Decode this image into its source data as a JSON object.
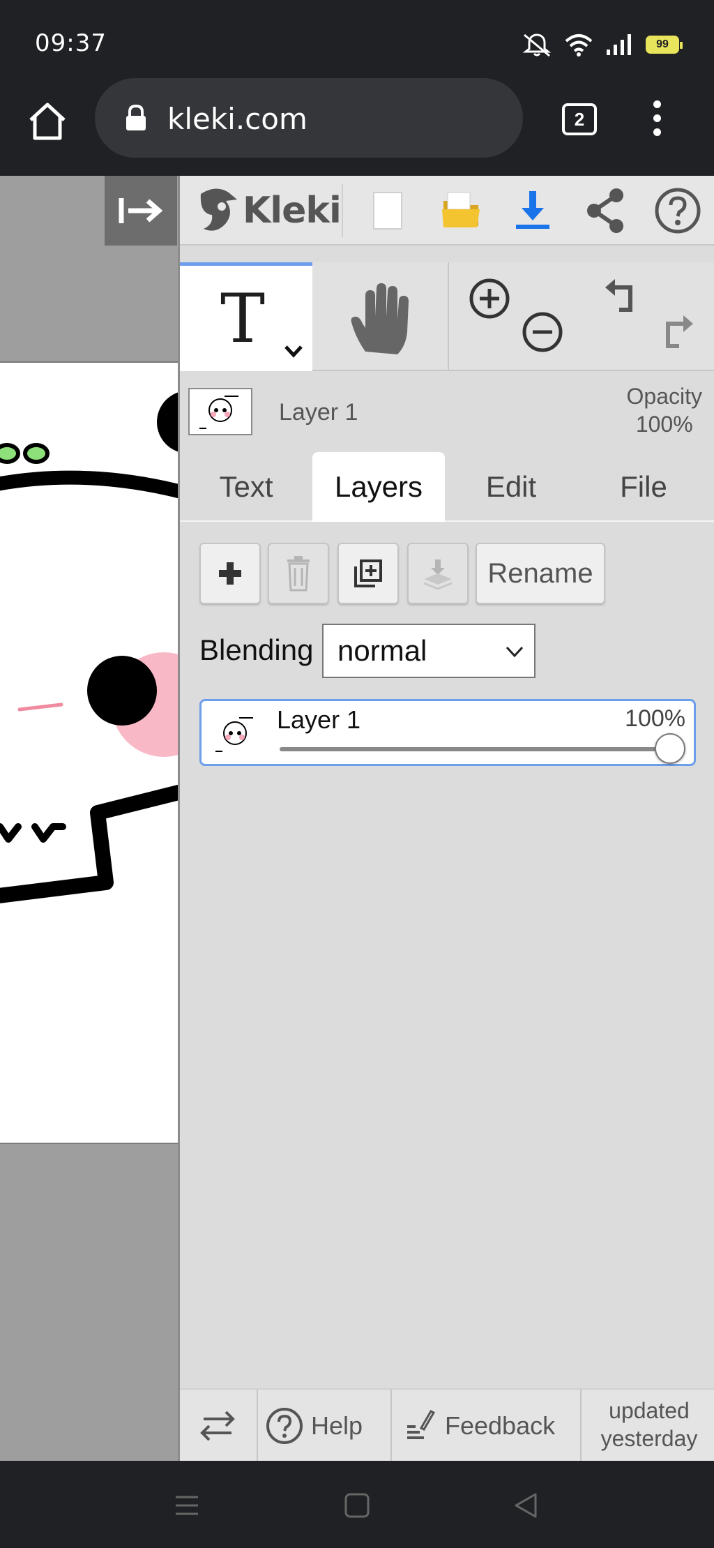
{
  "status_bar": {
    "time": "09:37",
    "battery": "99",
    "icons": [
      "mute-icon",
      "wifi-icon",
      "signal-icon",
      "battery-icon"
    ]
  },
  "browser": {
    "url": "kleki.com",
    "tab_count": "2"
  },
  "app": {
    "logo_text": "Kleki",
    "toolbar_icons": [
      "new-image-icon",
      "open-folder-icon",
      "download-icon",
      "share-icon",
      "help-icon"
    ],
    "tools": [
      "text-tool",
      "hand-tool",
      "zoom-in",
      "zoom-out",
      "undo",
      "redo"
    ],
    "current_layer": {
      "name": "Layer 1",
      "opacity_label": "Opacity",
      "opacity_value": "100%"
    },
    "tabs": [
      {
        "label": "Text",
        "active": false
      },
      {
        "label": "Layers",
        "active": true
      },
      {
        "label": "Edit",
        "active": false
      },
      {
        "label": "File",
        "active": false
      }
    ],
    "layer_buttons": {
      "rename_label": "Rename"
    },
    "blending": {
      "label": "Blending",
      "value": "normal"
    },
    "layers": [
      {
        "name": "Layer 1",
        "opacity": "100%",
        "opacity_fraction": 1.0
      }
    ],
    "bottom_bar": {
      "help_label": "Help",
      "feedback_label": "Feedback",
      "updated_line1": "updated",
      "updated_line2": "yesterday"
    }
  },
  "colors": {
    "accent_blue": "#6d9eeb",
    "download_blue": "#1a73e8",
    "folder_yellow": "#f4c430",
    "panel_bg": "#dcdcdc"
  }
}
